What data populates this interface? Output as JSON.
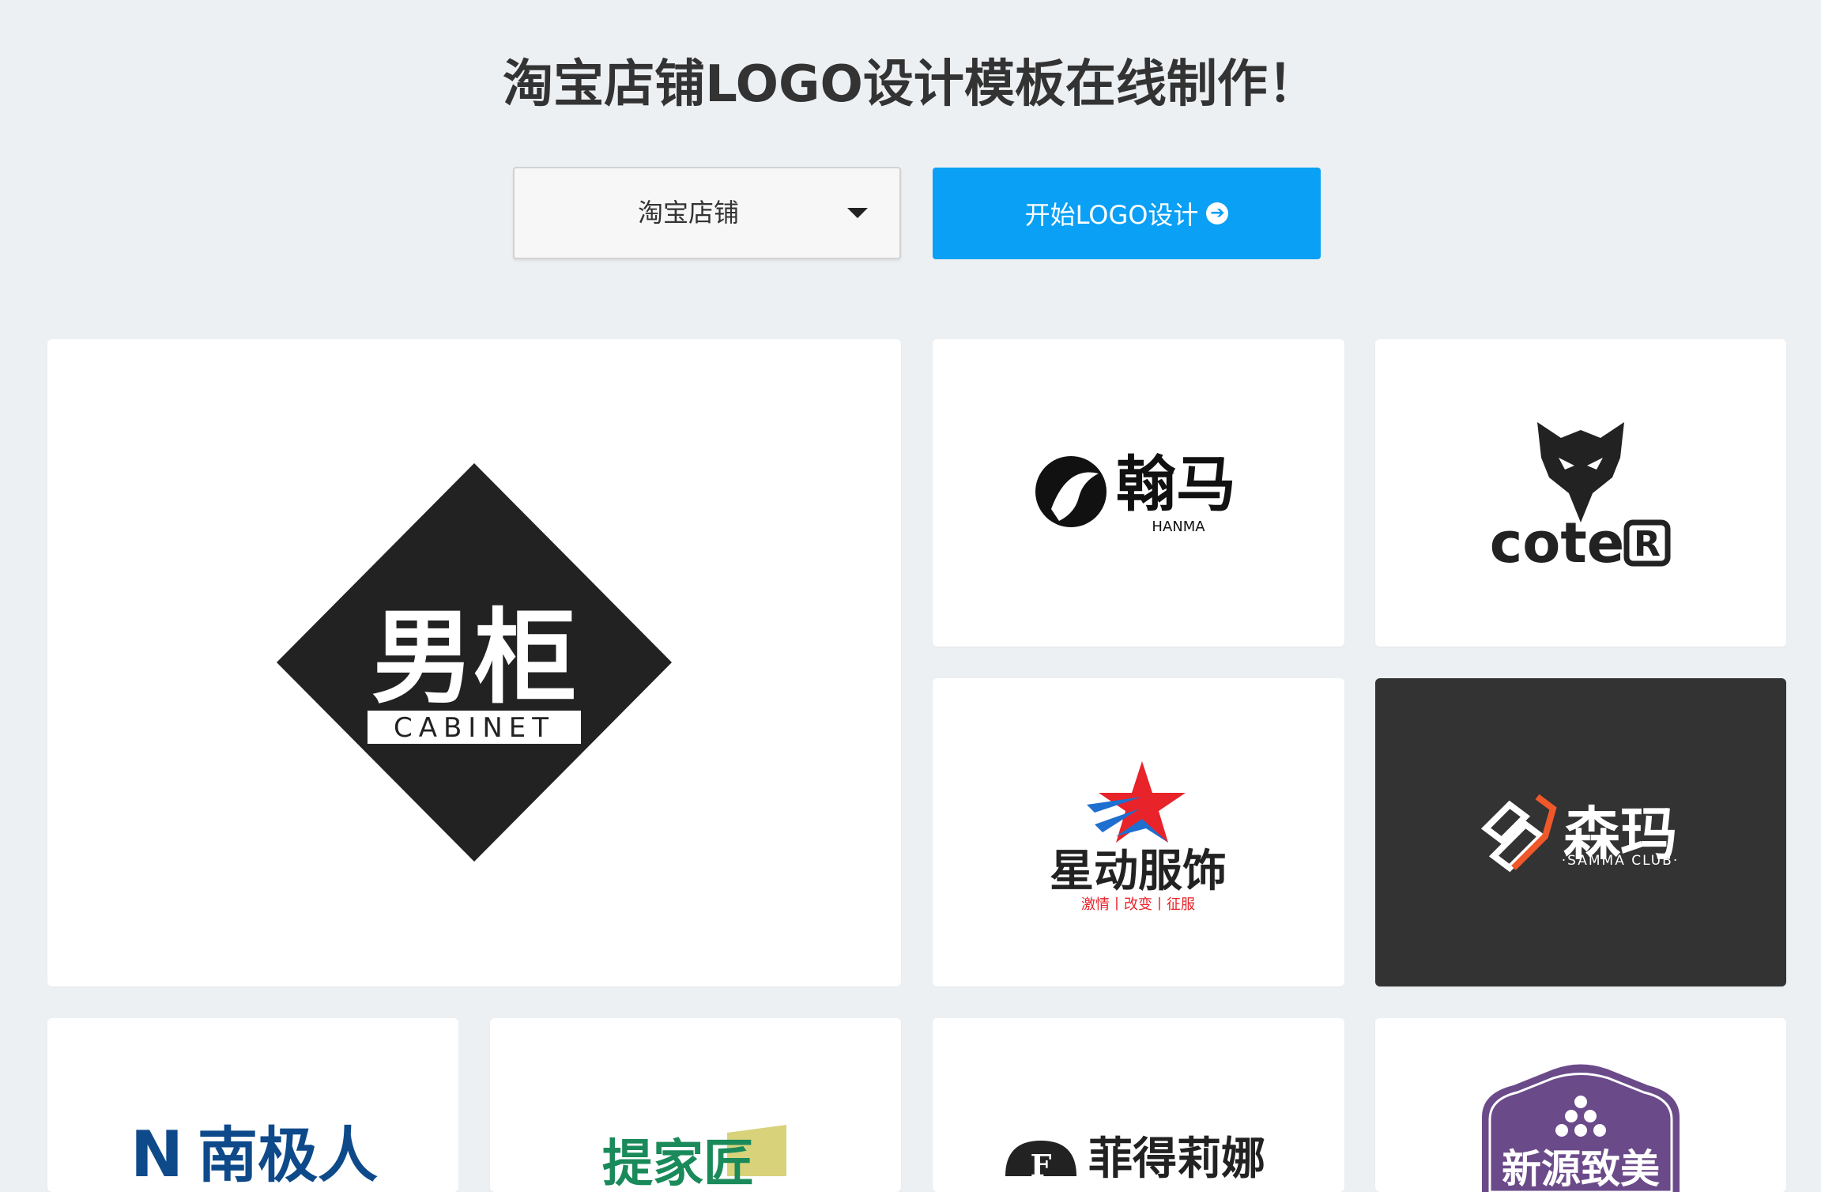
{
  "header": {
    "title": "淘宝店铺LOGO设计模板在线制作！"
  },
  "controls": {
    "category_select": {
      "selected": "淘宝店铺"
    },
    "start_button": {
      "label": "开始LOGO设计"
    }
  },
  "logos": {
    "cabinet": {
      "cn": "男柜",
      "en": "CABINET"
    },
    "hanma": {
      "cn": "翰马",
      "en": "HANMA"
    },
    "cote": {
      "name": "cote",
      "mark": "R"
    },
    "xingdong": {
      "cn": "星动服饰",
      "slogan": "激情丨改变丨征服"
    },
    "samma": {
      "cn": "森玛",
      "en": "·SAMMA CLUB·"
    },
    "nanjiren": {
      "cn": "南极人",
      "mark": "N"
    },
    "tijiajiang": {
      "cn": "提家匠"
    },
    "feidelina": {
      "cn": "菲得莉娜",
      "mark": "F"
    },
    "xinyuan": {
      "cn": "新源致美"
    }
  },
  "colors": {
    "accent": "#0aa0f5",
    "background": "#edf0f3",
    "dark_card": "#333333",
    "star_red": "#e8232a",
    "star_blue": "#1e6fcf",
    "samma_orange": "#f0582a",
    "nanjiren_blue": "#0e4a8a",
    "tijiajiang_green": "#1a8a5a",
    "xinyuan_purple": "#6b4a8a"
  },
  "icons": {
    "caret": "chevron-down-icon",
    "arrow": "arrow-right-circle-icon"
  }
}
